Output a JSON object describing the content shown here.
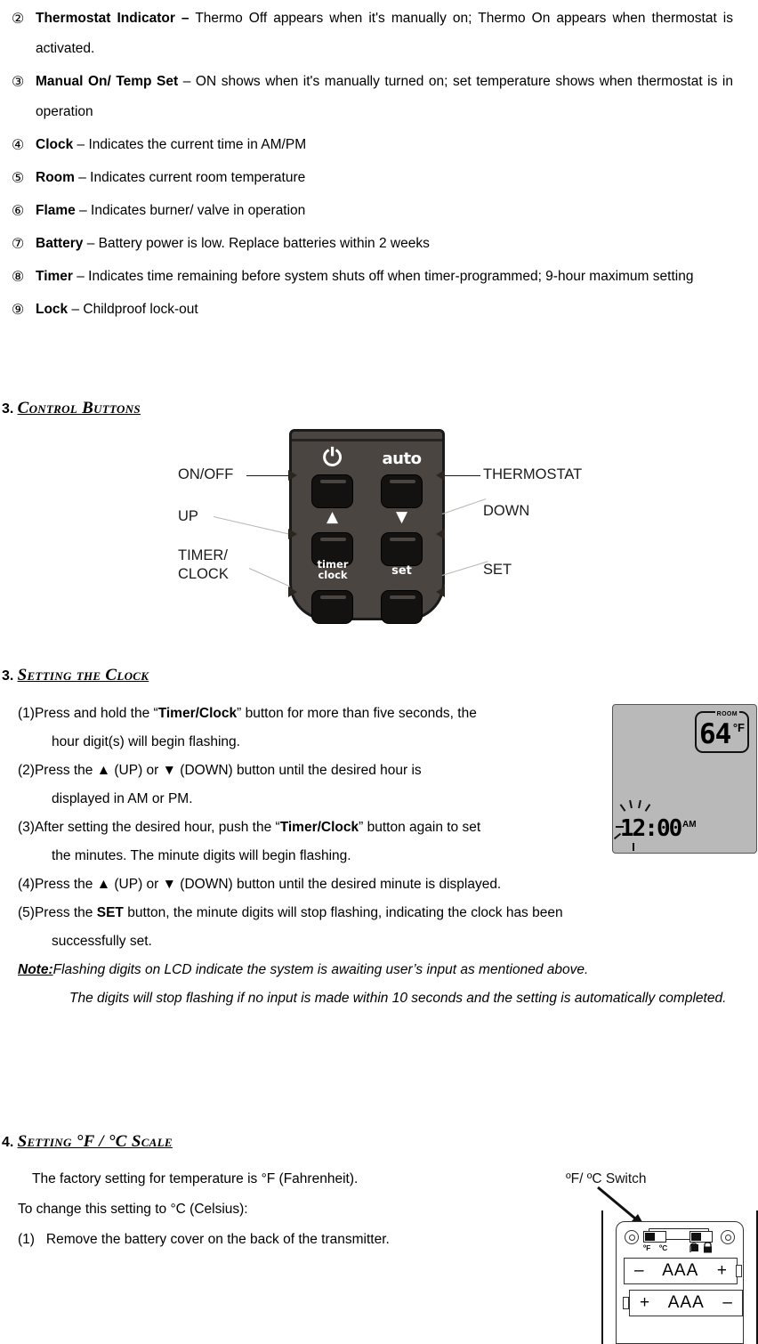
{
  "indicators": [
    {
      "num": "②",
      "term": "Thermostat Indicator –",
      "desc": " Thermo Off appears when it's manually on; Thermo On appears when thermostat is activated.",
      "justify": true
    },
    {
      "num": "③",
      "term": "Manual On/ Temp Set",
      "desc": " – ON shows when it's manually turned on; set temperature shows when thermostat is in operation",
      "justify": true
    },
    {
      "num": "④",
      "term": "Clock",
      "desc": " – Indicates the current time in AM/PM",
      "justify": false
    },
    {
      "num": "⑤",
      "term": "Room",
      "desc": " – Indicates current room temperature",
      "justify": false
    },
    {
      "num": "⑥",
      "term": "Flame",
      "desc": " – Indicates burner/ valve in operation",
      "justify": false
    },
    {
      "num": "⑦",
      "term": "Battery",
      "desc": " – Battery power is low. Replace batteries within 2 weeks",
      "justify": false
    },
    {
      "num": "⑧",
      "term": "Timer",
      "desc": " – Indicates time remaining before system shuts off when timer-programmed; 9-hour maximum setting",
      "justify": true
    },
    {
      "num": "⑨",
      "term": "Lock",
      "desc": " – Childproof lock-out",
      "justify": false
    }
  ],
  "sections": {
    "control_buttons": {
      "number": "3.",
      "title": "Control Buttons"
    },
    "setting_clock": {
      "number": "3.",
      "title": "Setting the Clock"
    },
    "setting_scale": {
      "number": "4.",
      "title": "Setting °F / °C Scale"
    }
  },
  "remote": {
    "glyphs": {
      "power": "⏻",
      "auto": "auto",
      "up": "▲",
      "down": "▼",
      "timer_line1": "timer",
      "timer_line2": "clock",
      "set": "set"
    },
    "labels_left": [
      {
        "text": "ON/OFF"
      },
      {
        "text": "UP"
      },
      {
        "text": "TIMER/\nCLOCK"
      }
    ],
    "labels_right": [
      {
        "text": "THERMOSTAT"
      },
      {
        "text": "DOWN"
      },
      {
        "text": "SET"
      }
    ],
    "body_color": "#4a4540",
    "button_color": "#141210"
  },
  "clock_steps": [
    {
      "num": "(1)",
      "pre": "Press and hold the “",
      "bold": "Timer/Clock",
      "post": "” button for more than five seconds, the",
      "cont": "hour digit(s) will begin flashing.",
      "width": "narrow"
    },
    {
      "num": "(2)",
      "pre": "Press the  ▲  (UP) or  ▼  (DOWN) button until the desired hour is",
      "bold": "",
      "post": "",
      "cont": "displayed in AM or PM.",
      "width": "narrow"
    },
    {
      "num": "(3)",
      "pre": "After setting the desired hour, push the “",
      "bold": "Timer/Clock",
      "post": "” button again to set",
      "cont": "the minutes. The minute digits will begin flashing.",
      "width": "narrow"
    },
    {
      "num": "(4)",
      "pre": "Press the  ▲  (UP) or  ▼  (DOWN) button until the desired minute is displayed.",
      "bold": "",
      "post": "",
      "cont": "",
      "width": "wide"
    },
    {
      "num": "(5)",
      "pre": "Press the ",
      "bold": "SET",
      "post": " button, the minute digits will stop flashing, indicating the clock has been",
      "cont": "successfully set.",
      "width": "wide"
    }
  ],
  "note": {
    "label": "Note:",
    "line1": "Flashing digits on LCD indicate the system is awaiting user’s input as mentioned above.",
    "line2": "The digits will stop flashing if no input is made within 10 seconds and the setting is automatically completed."
  },
  "lcd": {
    "room_label": "ROOM",
    "temperature": "64",
    "unit": "°F",
    "clock": "12:00",
    "ampm": "AM"
  },
  "scale_section": {
    "line1": "The factory setting for temperature is °F (Fahrenheit).",
    "line2": "To change this setting to °C (Celsius):",
    "step1_num": "(1)",
    "step1_text": "Remove the battery cover on the back of the transmitter."
  },
  "battery": {
    "switch_label": "ºF/ ºC Switch",
    "sw_f": "ºF",
    "sw_c": "ºC",
    "cell_top_left": "–",
    "cell_top_mid": "AAA",
    "cell_top_right": "+",
    "cell_bottom_left": "+",
    "cell_bottom_mid": "AAA",
    "cell_bottom_right": "–",
    "lock_icon": "🔒"
  }
}
